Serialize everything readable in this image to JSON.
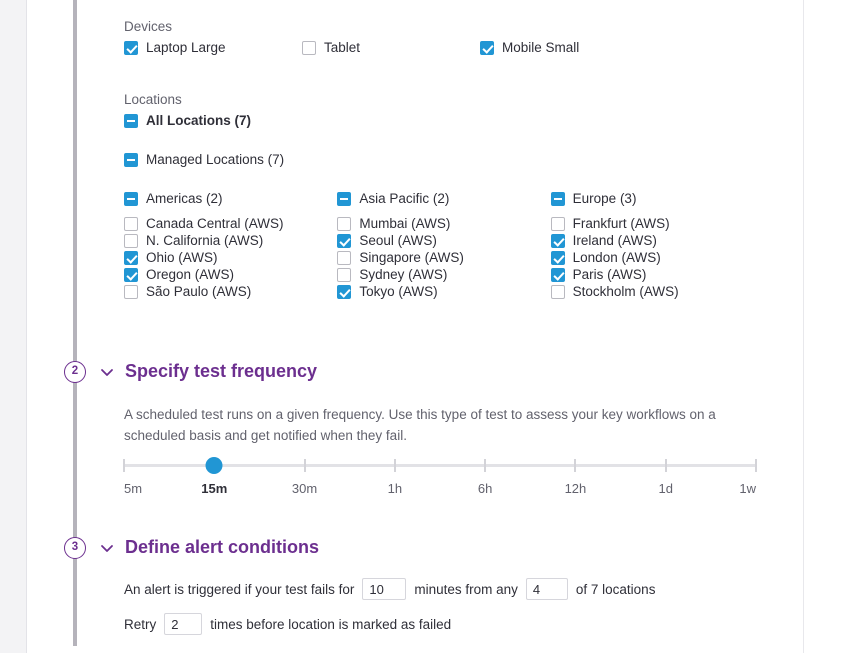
{
  "devices": {
    "label": "Devices",
    "items": [
      {
        "label": "Laptop Large",
        "state": "checked"
      },
      {
        "label": "Tablet",
        "state": "unchecked"
      },
      {
        "label": "Mobile Small",
        "state": "checked"
      }
    ]
  },
  "locations": {
    "label": "Locations",
    "all": {
      "label": "All Locations (7)",
      "state": "indeterminate"
    },
    "managed": {
      "label": "Managed Locations (7)",
      "state": "indeterminate"
    },
    "regions": [
      {
        "label": "Americas (2)",
        "state": "indeterminate",
        "items": [
          {
            "label": "Canada Central (AWS)",
            "state": "unchecked"
          },
          {
            "label": "N. California (AWS)",
            "state": "unchecked"
          },
          {
            "label": "Ohio (AWS)",
            "state": "checked"
          },
          {
            "label": "Oregon (AWS)",
            "state": "checked"
          },
          {
            "label": "São Paulo (AWS)",
            "state": "unchecked"
          }
        ]
      },
      {
        "label": "Asia Pacific (2)",
        "state": "indeterminate",
        "items": [
          {
            "label": "Mumbai (AWS)",
            "state": "unchecked"
          },
          {
            "label": "Seoul (AWS)",
            "state": "checked"
          },
          {
            "label": "Singapore (AWS)",
            "state": "unchecked"
          },
          {
            "label": "Sydney (AWS)",
            "state": "unchecked"
          },
          {
            "label": "Tokyo (AWS)",
            "state": "checked"
          }
        ]
      },
      {
        "label": "Europe (3)",
        "state": "indeterminate",
        "items": [
          {
            "label": "Frankfurt (AWS)",
            "state": "unchecked"
          },
          {
            "label": "Ireland (AWS)",
            "state": "checked"
          },
          {
            "label": "London (AWS)",
            "state": "checked"
          },
          {
            "label": "Paris (AWS)",
            "state": "checked"
          },
          {
            "label": "Stockholm (AWS)",
            "state": "unchecked"
          }
        ]
      }
    ]
  },
  "step2": {
    "number": "2",
    "title": "Specify test frequency",
    "description": "A scheduled test runs on a given frequency. Use this type of test to assess your key workflows on a scheduled basis and get notified when they fail.",
    "slider": {
      "ticks": [
        "5m",
        "15m",
        "30m",
        "1h",
        "6h",
        "12h",
        "1d",
        "1w"
      ],
      "selected_index": 1,
      "selected_value": "15m"
    }
  },
  "step3": {
    "number": "3",
    "title": "Define alert conditions",
    "line1_prefix": "An alert is triggered if your test fails for",
    "minutes_value": "10",
    "line1_middle": "minutes from any",
    "locations_value": "4",
    "line1_suffix": "of 7 locations",
    "line2_prefix": "Retry",
    "retry_value": "2",
    "line2_suffix": "times before location is marked as failed"
  },
  "colors": {
    "accent_purple": "#6c2f8f",
    "checkbox_blue": "#2196d4",
    "rail_gray": "#b5b3bb"
  }
}
